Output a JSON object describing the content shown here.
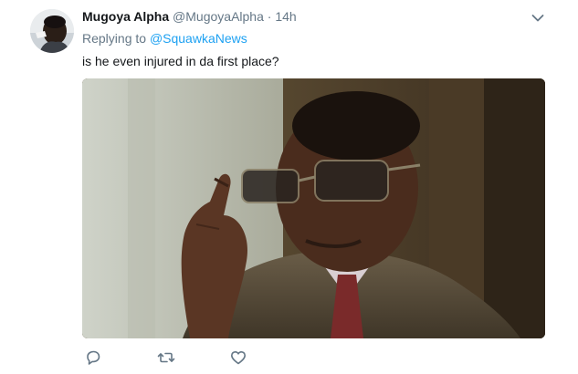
{
  "tweet": {
    "display_name": "Mugoya Alpha",
    "handle": "@MugoyaAlpha",
    "separator": "·",
    "time": "14h",
    "replying_prefix": "Replying to",
    "replying_to": "@SquawkaNews",
    "text": "is he even injured in da first place?"
  },
  "icons": {
    "menu": "chevron-down-icon",
    "reply": "reply-icon",
    "retweet": "retweet-icon",
    "like": "heart-icon"
  },
  "colors": {
    "link": "#1da1f2",
    "secondary_text": "#657786",
    "primary_text": "#14171a",
    "icon": "#657786"
  }
}
